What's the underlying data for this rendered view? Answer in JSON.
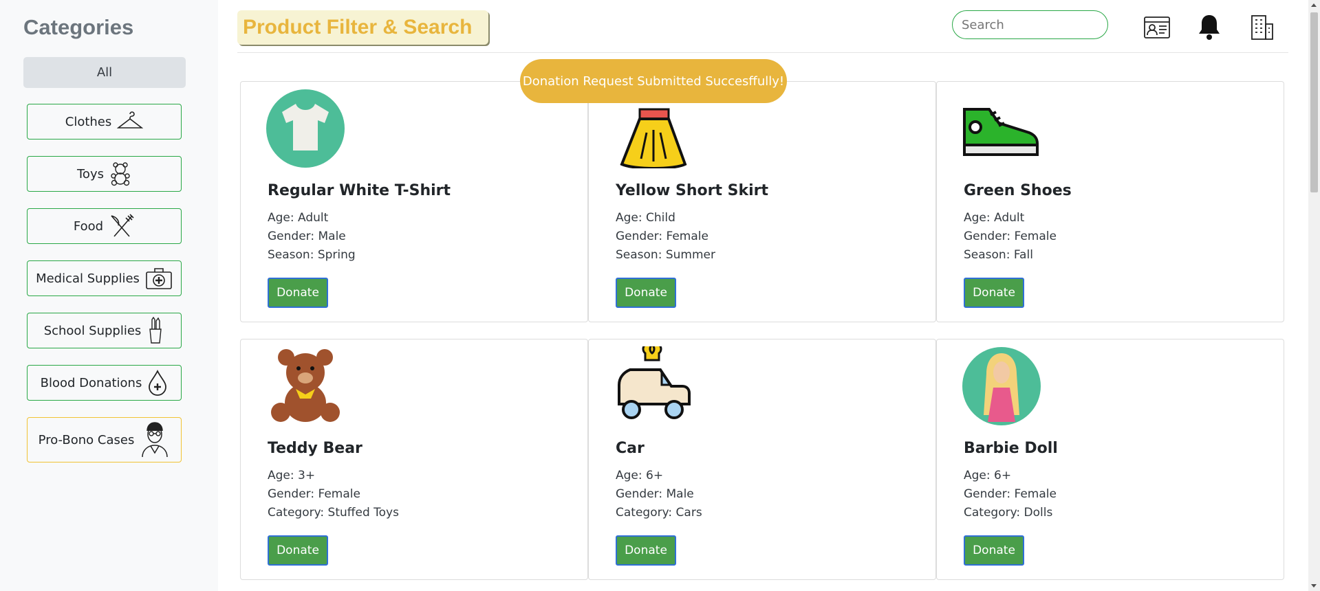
{
  "sidebar": {
    "title": "Categories",
    "all_label": "All",
    "items": [
      {
        "label": "Clothes",
        "icon": "hanger-icon"
      },
      {
        "label": "Toys",
        "icon": "teddy-bear-icon"
      },
      {
        "label": "Food",
        "icon": "fork-knife-icon"
      },
      {
        "label": "Medical Supplies",
        "icon": "first-aid-kit-icon"
      },
      {
        "label": "School Supplies",
        "icon": "pencil-cup-icon"
      },
      {
        "label": "Blood Donations",
        "icon": "blood-drop-icon"
      },
      {
        "label": "Pro-Bono Cases",
        "icon": "doctor-icon"
      }
    ]
  },
  "header": {
    "title": "Product Filter & Search",
    "search_placeholder": "Search",
    "icons": [
      "id-card-icon",
      "bell-icon",
      "building-icon"
    ]
  },
  "toast": "Donation Request Submitted Succesffully!",
  "products": [
    {
      "name": "Regular White T-Shirt",
      "attrs": [
        "Age: Adult",
        "Gender: Male",
        "Season: Spring"
      ],
      "icon": "t-shirt-icon",
      "button": "Donate"
    },
    {
      "name": "Yellow Short Skirt",
      "attrs": [
        "Age: Child",
        "Gender: Female",
        "Season: Summer"
      ],
      "icon": "skirt-icon",
      "button": "Donate"
    },
    {
      "name": "Green Shoes",
      "attrs": [
        "Age: Adult",
        "Gender: Female",
        "Season: Fall"
      ],
      "icon": "sneaker-icon",
      "button": "Donate"
    },
    {
      "name": "Teddy Bear",
      "attrs": [
        "Age: 3+",
        "Gender: Female",
        "Category: Stuffed Toys"
      ],
      "icon": "teddy-bear-icon",
      "button": "Donate"
    },
    {
      "name": "Car",
      "attrs": [
        "Age: 6+",
        "Gender: Male",
        "Category: Cars"
      ],
      "icon": "toy-car-icon",
      "button": "Donate"
    },
    {
      "name": "Barbie Doll",
      "attrs": [
        "Age: 6+",
        "Gender: Female",
        "Category: Dolls"
      ],
      "icon": "doll-icon",
      "button": "Donate"
    }
  ],
  "colors": {
    "accent_green": "#28a745",
    "donate_green": "#4a9e4a",
    "toast_yellow": "#e8b53d"
  }
}
